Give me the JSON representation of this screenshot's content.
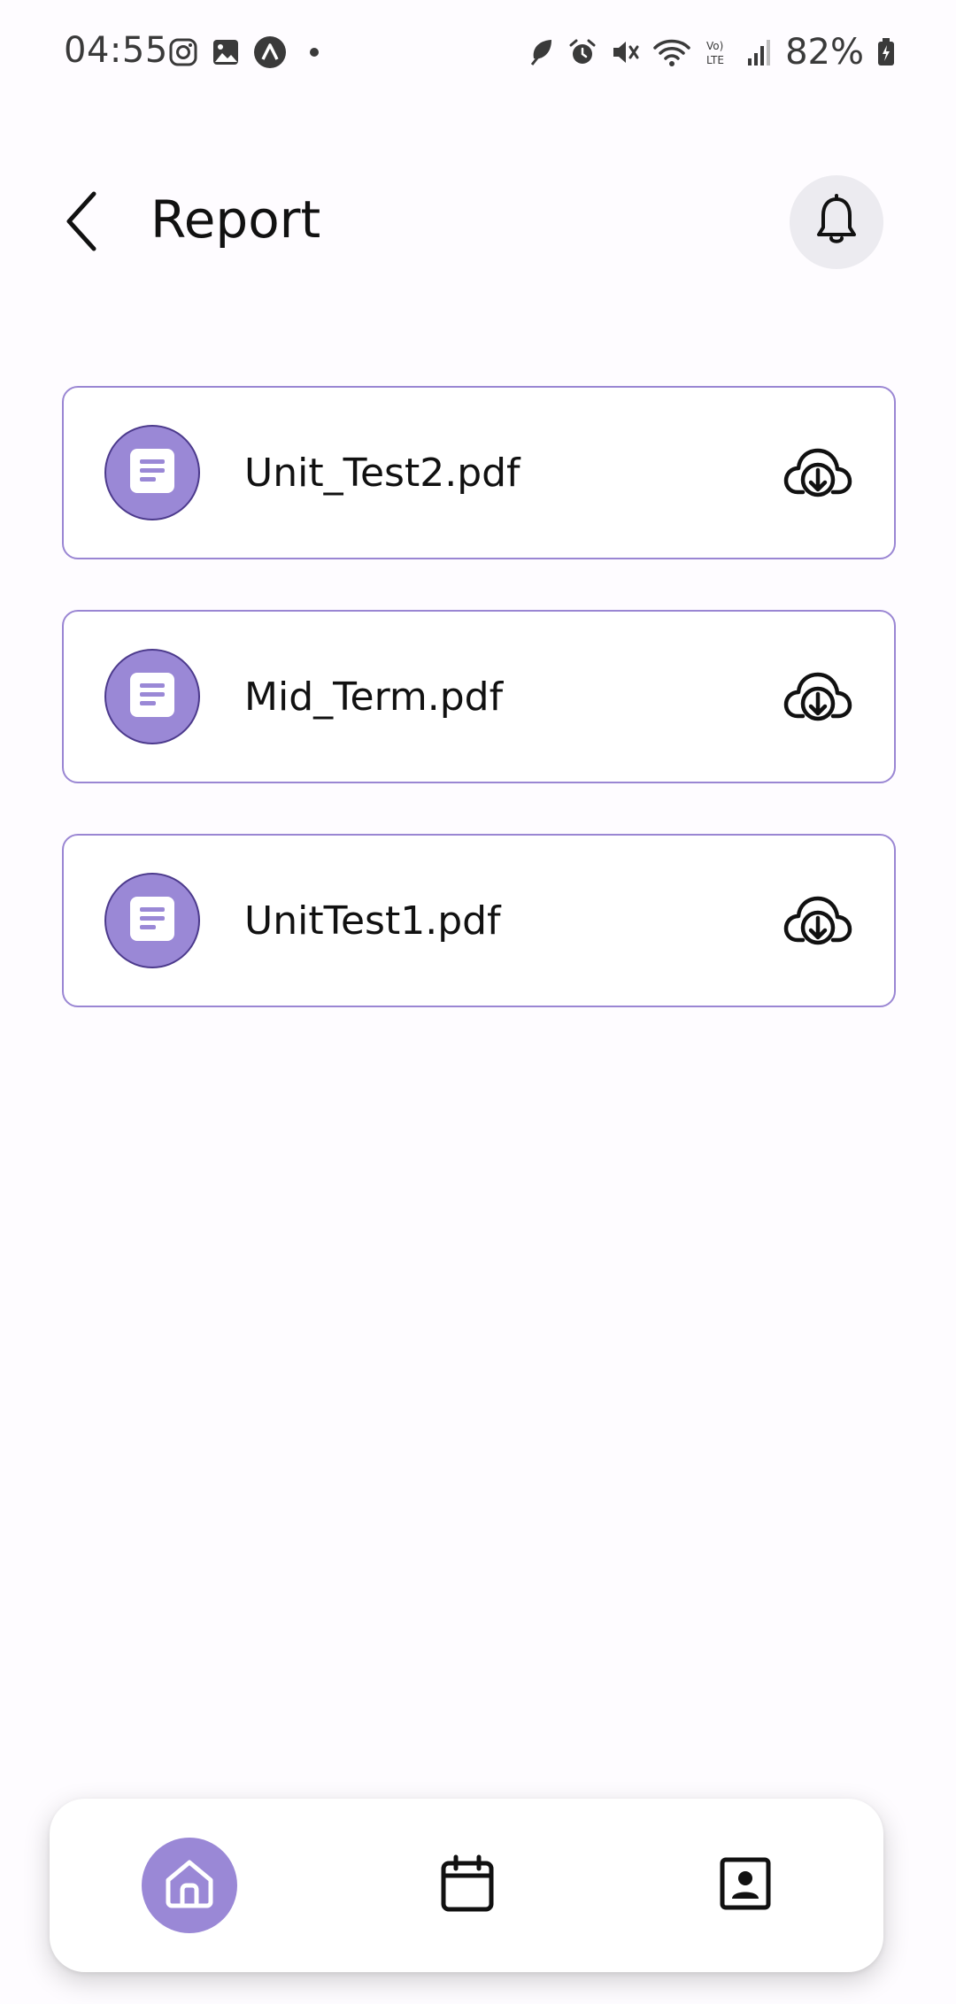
{
  "status_bar": {
    "time": "04:55",
    "battery": "82%",
    "left_icons": [
      "instagram-icon",
      "gallery-icon",
      "app-icon",
      "dot-icon"
    ],
    "right_icons": [
      "leaf-icon",
      "alarm-icon",
      "mute-icon",
      "wifi-icon",
      "volte-icon",
      "signal-icon",
      "battery-icon"
    ]
  },
  "header": {
    "title": "Report",
    "back_icon": "chevron-left-icon",
    "notification_icon": "bell-icon"
  },
  "files": [
    {
      "name": "Unit_Test2.pdf",
      "icon": "document-icon",
      "action_icon": "cloud-download-icon"
    },
    {
      "name": "Mid_Term.pdf",
      "icon": "document-icon",
      "action_icon": "cloud-download-icon"
    },
    {
      "name": "UnitTest1.pdf",
      "icon": "document-icon",
      "action_icon": "cloud-download-icon"
    }
  ],
  "bottom_nav": {
    "items": [
      {
        "id": "home",
        "icon": "home-icon",
        "active": true
      },
      {
        "id": "calendar",
        "icon": "calendar-icon",
        "active": false
      },
      {
        "id": "profile",
        "icon": "contact-card-icon",
        "active": false
      }
    ]
  },
  "colors": {
    "accent": "#9a88d6",
    "card_border": "#9a86d3",
    "avatar_border": "#4c3a8c",
    "notif_bg": "#ecebf0",
    "background": "#fefcff"
  }
}
